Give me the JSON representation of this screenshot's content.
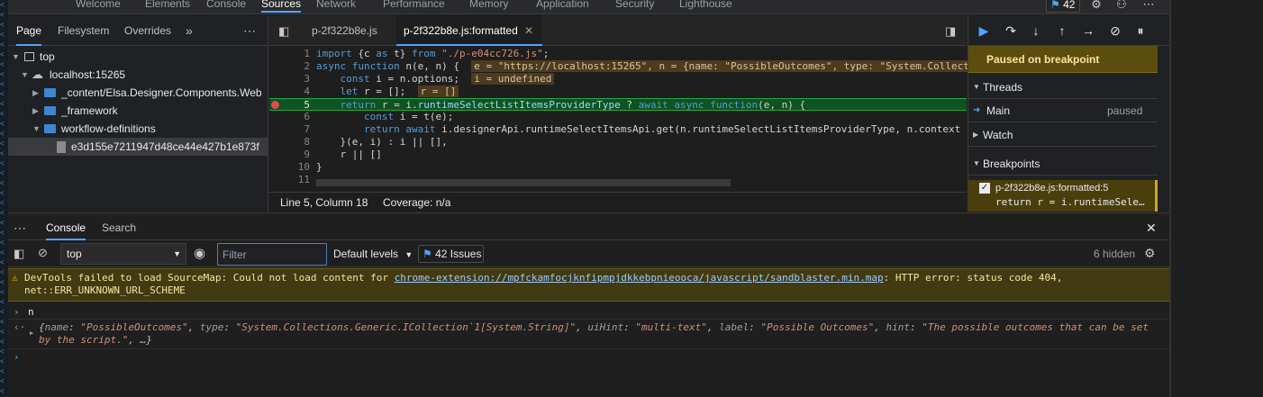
{
  "top_tabs": [
    "Welcome",
    "Elements",
    "Console",
    "Sources",
    "Network",
    "Performance",
    "Memory",
    "Application",
    "Security",
    "Lighthouse"
  ],
  "issues_count": "42",
  "navigator": {
    "tabs": [
      "Page",
      "Filesystem",
      "Overrides"
    ],
    "tree": [
      {
        "label": "top"
      },
      {
        "label": "localhost:15265"
      },
      {
        "label": "_content/Elsa.Designer.Components.Web"
      },
      {
        "label": "_framework"
      },
      {
        "label": "workflow-definitions"
      },
      {
        "label": "e3d155e7211947d48ce44e427b1e873f"
      }
    ]
  },
  "editor": {
    "tabs": [
      "p-2f322b8e.js",
      "p-2f322b8e.js:formatted"
    ],
    "line_numbers": [
      "1",
      "2",
      "3",
      "4",
      "5",
      "6",
      "7",
      "8",
      "9",
      "10",
      "11"
    ],
    "lines": [
      {
        "parts": [
          {
            "t": "import",
            "c": "kw"
          },
          {
            "t": " {c "
          },
          {
            "t": "as",
            "c": "kw"
          },
          {
            "t": " t} "
          },
          {
            "t": "from",
            "c": "kw"
          },
          {
            "t": " "
          },
          {
            "t": "\"./p-e04cc726.js\"",
            "c": "st"
          },
          {
            "t": ";"
          }
        ]
      },
      {
        "parts": [
          {
            "t": "async function",
            "c": "kw"
          },
          {
            "t": " n(e, n) {  "
          },
          {
            "t": "e = \"https://localhost:15265\", n = {name: \"PossibleOutcomes\", type: \"System.Collect",
            "c": "iv"
          }
        ]
      },
      {
        "parts": [
          {
            "t": "    "
          },
          {
            "t": "const",
            "c": "kw"
          },
          {
            "t": " i = n.options;  "
          },
          {
            "t": "i = undefined",
            "c": "iv"
          }
        ]
      },
      {
        "parts": [
          {
            "t": "    "
          },
          {
            "t": "let",
            "c": "kw"
          },
          {
            "t": " r = [];  "
          },
          {
            "t": "r = []",
            "c": "iv"
          }
        ]
      },
      {
        "parts": [
          {
            "t": "    "
          },
          {
            "t": "return",
            "c": "kw"
          },
          {
            "t": " r = i."
          },
          {
            "t": "runtimeSelectListItemsProviderType",
            "c": "id"
          },
          {
            "t": " ? "
          },
          {
            "t": "await async function",
            "c": "kw"
          },
          {
            "t": "(e, n) {"
          }
        ]
      },
      {
        "parts": [
          {
            "t": "        "
          },
          {
            "t": "const",
            "c": "kw"
          },
          {
            "t": " i = t(e);"
          }
        ]
      },
      {
        "parts": [
          {
            "t": "        "
          },
          {
            "t": "return await",
            "c": "kw"
          },
          {
            "t": " i.designerApi.runtimeSelectItemsApi.get(n.runtimeSelectListItemsProviderType, n.context"
          }
        ]
      },
      {
        "parts": [
          {
            "t": "    }(e, i) : i || [],"
          }
        ]
      },
      {
        "parts": [
          {
            "t": "    r || []"
          }
        ]
      },
      {
        "parts": [
          {
            "t": "}"
          }
        ]
      },
      {
        "parts": [
          {
            "t": ""
          }
        ]
      }
    ],
    "status": "Line 5, Column 18",
    "coverage": "Coverage: n/a"
  },
  "debugger": {
    "paused": "Paused on breakpoint",
    "threads": "Threads",
    "thread_name": "Main",
    "thread_state": "paused",
    "watch": "Watch",
    "breakpoints": "Breakpoints",
    "bp_file": "p-2f322b8e.js:formatted:5",
    "bp_code": "return r = i.runtimeSele…"
  },
  "drawer": {
    "tabs": [
      "Console",
      "Search"
    ],
    "context": "top",
    "filter_placeholder": "Filter",
    "levels": "Default levels",
    "issues": "42 Issues",
    "hidden": "6 hidden",
    "warning_prefix": "DevTools failed to load SourceMap: Could not load content for ",
    "warning_link": "chrome-extension://mpfckamfocjknfipmpjdkkebpnieooca/javascript/sandblaster.min.map",
    "warning_suffix": ": HTTP error: status code 404,",
    "warning_line2": "net::ERR_UNKNOWN_URL_SCHEME",
    "input_cmd": "n",
    "result": {
      "name_key": "name",
      "name_val": "\"PossibleOutcomes\"",
      "type_key": "type",
      "type_val": "\"System.Collections.Generic.ICollection`1[System.String]\"",
      "uihint_key": "uiHint",
      "uihint_val": "\"multi-text\"",
      "label_key": "label",
      "label_val": "\"Possible Outcomes\"",
      "hint_key": "hint",
      "hint_val": "\"The possible outcomes that can be set",
      "hint_val2": "by the script.\"",
      "tail": ", …}"
    }
  }
}
